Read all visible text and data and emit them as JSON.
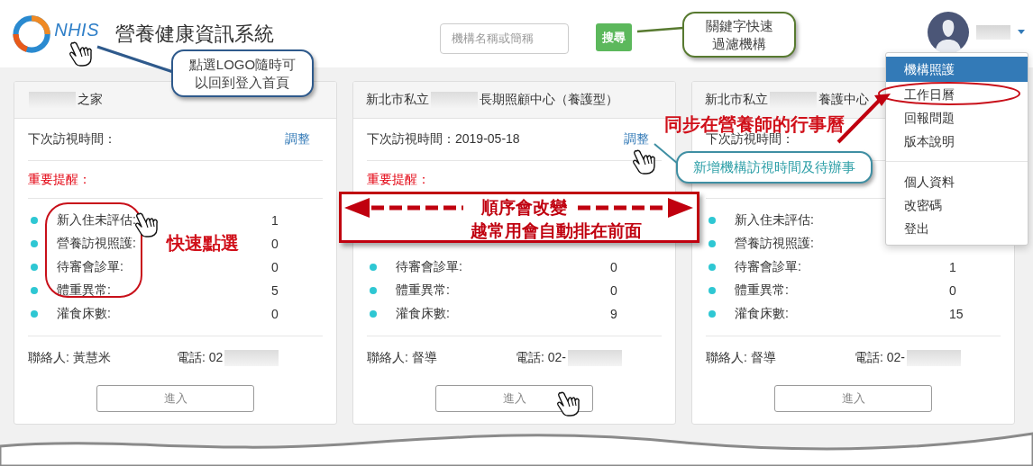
{
  "header": {
    "logo_text": "NHIS",
    "title": "營養健康資訊系統",
    "search": {
      "placeholder": "機構名稱或簡稱"
    },
    "search_button": "搜尋"
  },
  "user_menu": {
    "expanded": true,
    "groups": [
      {
        "items": [
          {
            "label": "機構照護",
            "selected": true
          },
          {
            "label": "工作日曆",
            "selected": false
          },
          {
            "label": "回報問題",
            "selected": false
          },
          {
            "label": "版本說明",
            "selected": false
          }
        ]
      },
      {
        "items": [
          {
            "label": "個人資料",
            "selected": false
          },
          {
            "label": "改密碼",
            "selected": false
          },
          {
            "label": "登出",
            "selected": false
          }
        ]
      }
    ]
  },
  "cards": [
    {
      "title_after": "之家",
      "next_visit": "下次訪視時間：",
      "adjust_link": "調整",
      "reminder": "重要提醒：",
      "stats": [
        {
          "label": "新入住未評估:",
          "value": "1"
        },
        {
          "label": "營養訪視照護:",
          "value": "0"
        },
        {
          "label": "待審會診單:",
          "value": "0"
        },
        {
          "label": "體重異常:",
          "value": "5"
        },
        {
          "label": "灌食床數:",
          "value": "0"
        }
      ],
      "contact": "聯絡人: 黃慧米",
      "phone": "電話: 02",
      "enter_button": "進入"
    },
    {
      "title_before": "新北市私立",
      "title_after": "長期照顧中心（養護型）",
      "next_visit": "下次訪視時間：2019-05-18",
      "adjust_link": "調整",
      "reminder": "重要提醒：",
      "stats": [
        {
          "label": "待審會診單:",
          "value": "0"
        },
        {
          "label": "體重異常:",
          "value": "0"
        },
        {
          "label": "灌食床數:",
          "value": "9"
        }
      ],
      "contact": "聯絡人: 督導",
      "phone": "電話: 02-",
      "enter_button": "進入"
    },
    {
      "title_before": "新北市私立",
      "title_after": "養護中心",
      "next_visit": "下次訪視時間：",
      "stats": [
        {
          "label": "新入住未評估:"
        },
        {
          "label": "營養訪視照護:"
        },
        {
          "label": "待審會診單:",
          "value": "1"
        },
        {
          "label": "體重異常:",
          "value": "0"
        },
        {
          "label": "灌食床數:",
          "value": "15"
        }
      ],
      "contact": "聯絡人: 督導",
      "phone": "電話: 02-",
      "enter_button": "進入"
    }
  ],
  "annotations": [
    {
      "kind": "callout",
      "lines": [
        "點選LOGO隨時可",
        "以回到登入首頁"
      ]
    },
    {
      "kind": "callout",
      "lines": [
        "關鍵字快速",
        "過濾機構"
      ]
    },
    {
      "kind": "banner",
      "lines": [
        "順序會改變",
        "越常用會自動排在前面"
      ]
    },
    {
      "kind": "note",
      "text": "快速點選"
    },
    {
      "kind": "note",
      "text": "同步在營養師的行事曆"
    },
    {
      "kind": "callout",
      "lines": [
        "新增機構訪視時間及待辦事"
      ]
    }
  ]
}
